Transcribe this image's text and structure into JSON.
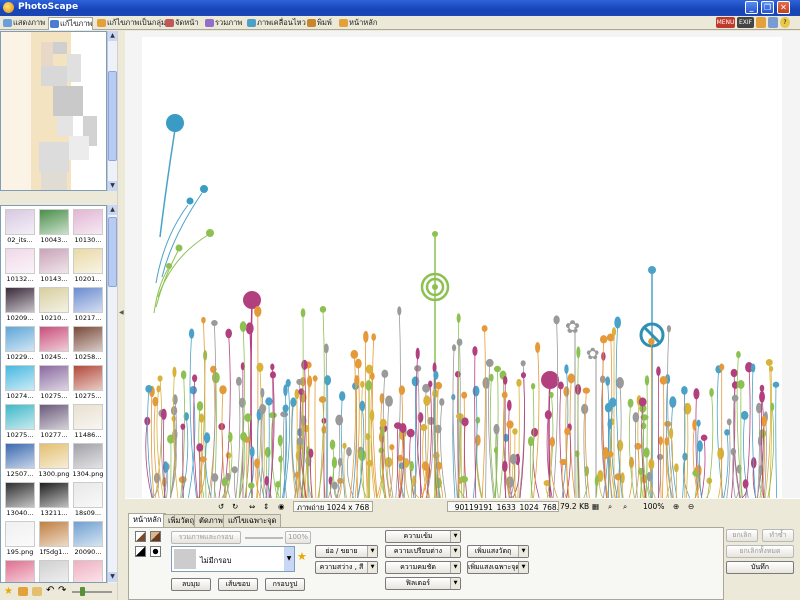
{
  "window": {
    "title": "PhotoScape"
  },
  "tabs": [
    {
      "label": "แสดงภาพ",
      "color": "#6b9edb"
    },
    {
      "label": "แก้ไขภาพ",
      "color": "#4a7dcf",
      "active": true
    },
    {
      "label": "แก้ไขภาพเป็นกลุ่ม",
      "color": "#e3a13b"
    },
    {
      "label": "จัดหน้า",
      "color": "#c05a5a"
    },
    {
      "label": "รวมภาพ",
      "color": "#8f6fc9"
    },
    {
      "label": "ภาพเคลื่อนไหว",
      "color": "#4fa0c8"
    },
    {
      "label": "พิมพ์",
      "color": "#c9872d"
    },
    {
      "label": "หน้าหลัก",
      "color": "#e3a13b"
    }
  ],
  "tab_icons": {
    "menu": "MENU",
    "exif": "EXIF"
  },
  "thumbnails": [
    {
      "label": "02_its...",
      "color": "#d8c8e0"
    },
    {
      "label": "10043...",
      "color": "#4a8f4a"
    },
    {
      "label": "10130...",
      "color": "#e2b5d3"
    },
    {
      "label": "10132...",
      "color": "#f0d8e8"
    },
    {
      "label": "10143...",
      "color": "#c9a3b8"
    },
    {
      "label": "10201...",
      "color": "#e9d9a6"
    },
    {
      "label": "10209...",
      "color": "#3a2a3a"
    },
    {
      "label": "10210...",
      "color": "#d7cfa0"
    },
    {
      "label": "10217...",
      "color": "#6b8ccf"
    },
    {
      "label": "10229...",
      "color": "#5fa6d8"
    },
    {
      "label": "10245...",
      "color": "#c94f7a"
    },
    {
      "label": "10258...",
      "color": "#7a4a3a"
    },
    {
      "label": "10274...",
      "color": "#48b8e0"
    },
    {
      "label": "10275...",
      "color": "#8a6aa0"
    },
    {
      "label": "10275...",
      "color": "#b24a3a"
    },
    {
      "label": "10275...",
      "color": "#3fb8c8"
    },
    {
      "label": "10277...",
      "color": "#6a5a7a"
    },
    {
      "label": "11486...",
      "color": "#e8e0d0"
    },
    {
      "label": "12507...",
      "color": "#3a6ab0"
    },
    {
      "label": "1300.png",
      "color": "#e3c070"
    },
    {
      "label": "1304.png",
      "color": "#a0a0a8"
    },
    {
      "label": "13040...",
      "color": "#303030"
    },
    {
      "label": "13211...",
      "color": "#202020"
    },
    {
      "label": "18s09...",
      "color": "#e8e8e8"
    },
    {
      "label": "195.png",
      "color": "#f0f0f0"
    },
    {
      "label": "1f5dg1...",
      "color": "#c08040"
    },
    {
      "label": "20090...",
      "color": "#70a0d0"
    },
    {
      "label": "",
      "color": "#e07090"
    },
    {
      "label": "",
      "color": "#d0d0d0"
    },
    {
      "label": "",
      "color": "#f0b0c0"
    }
  ],
  "image_toolbar": {
    "size_label": "ภาพถ่าย 1024 x 768",
    "filename": "_90119191_1633_1024_768.jpg",
    "filesize": "79.2 KB",
    "zoom": "100%"
  },
  "editor": {
    "tabs": [
      "หน้าหลัก",
      "เพิ่มวัตถุ",
      "ตัดภาพ",
      "แก้ไขเฉพาะจุด"
    ],
    "frame_merge_label": "รวมภาพและกรอบ",
    "frame_percent": "100%",
    "frame_select": "ไม่มีกรอบ",
    "round_label": "ลบมุม",
    "margin_label": "เส้นขอบ",
    "frame_label": "กรอบรูป",
    "resize_label": "ย่อ / ขยาย",
    "bright_label": "ความสว่าง , สี",
    "sharp_label": "ความคมชัด",
    "contrast_label": "ความเข้ม",
    "backlight_label": "ความเปรียบต่าง",
    "filter_label": "ฟิลเตอร์",
    "add_object_label": "เพิ่มแสงวัตถุ",
    "add_special_label": "เพิ่มแสงเฉพาะจุด",
    "undo_label": "ยกเลิก",
    "redo_label": "ทำซ้ำ",
    "undo_all_label": "ยกเลิกทั้งหมด",
    "save_label": "บันทึก"
  }
}
